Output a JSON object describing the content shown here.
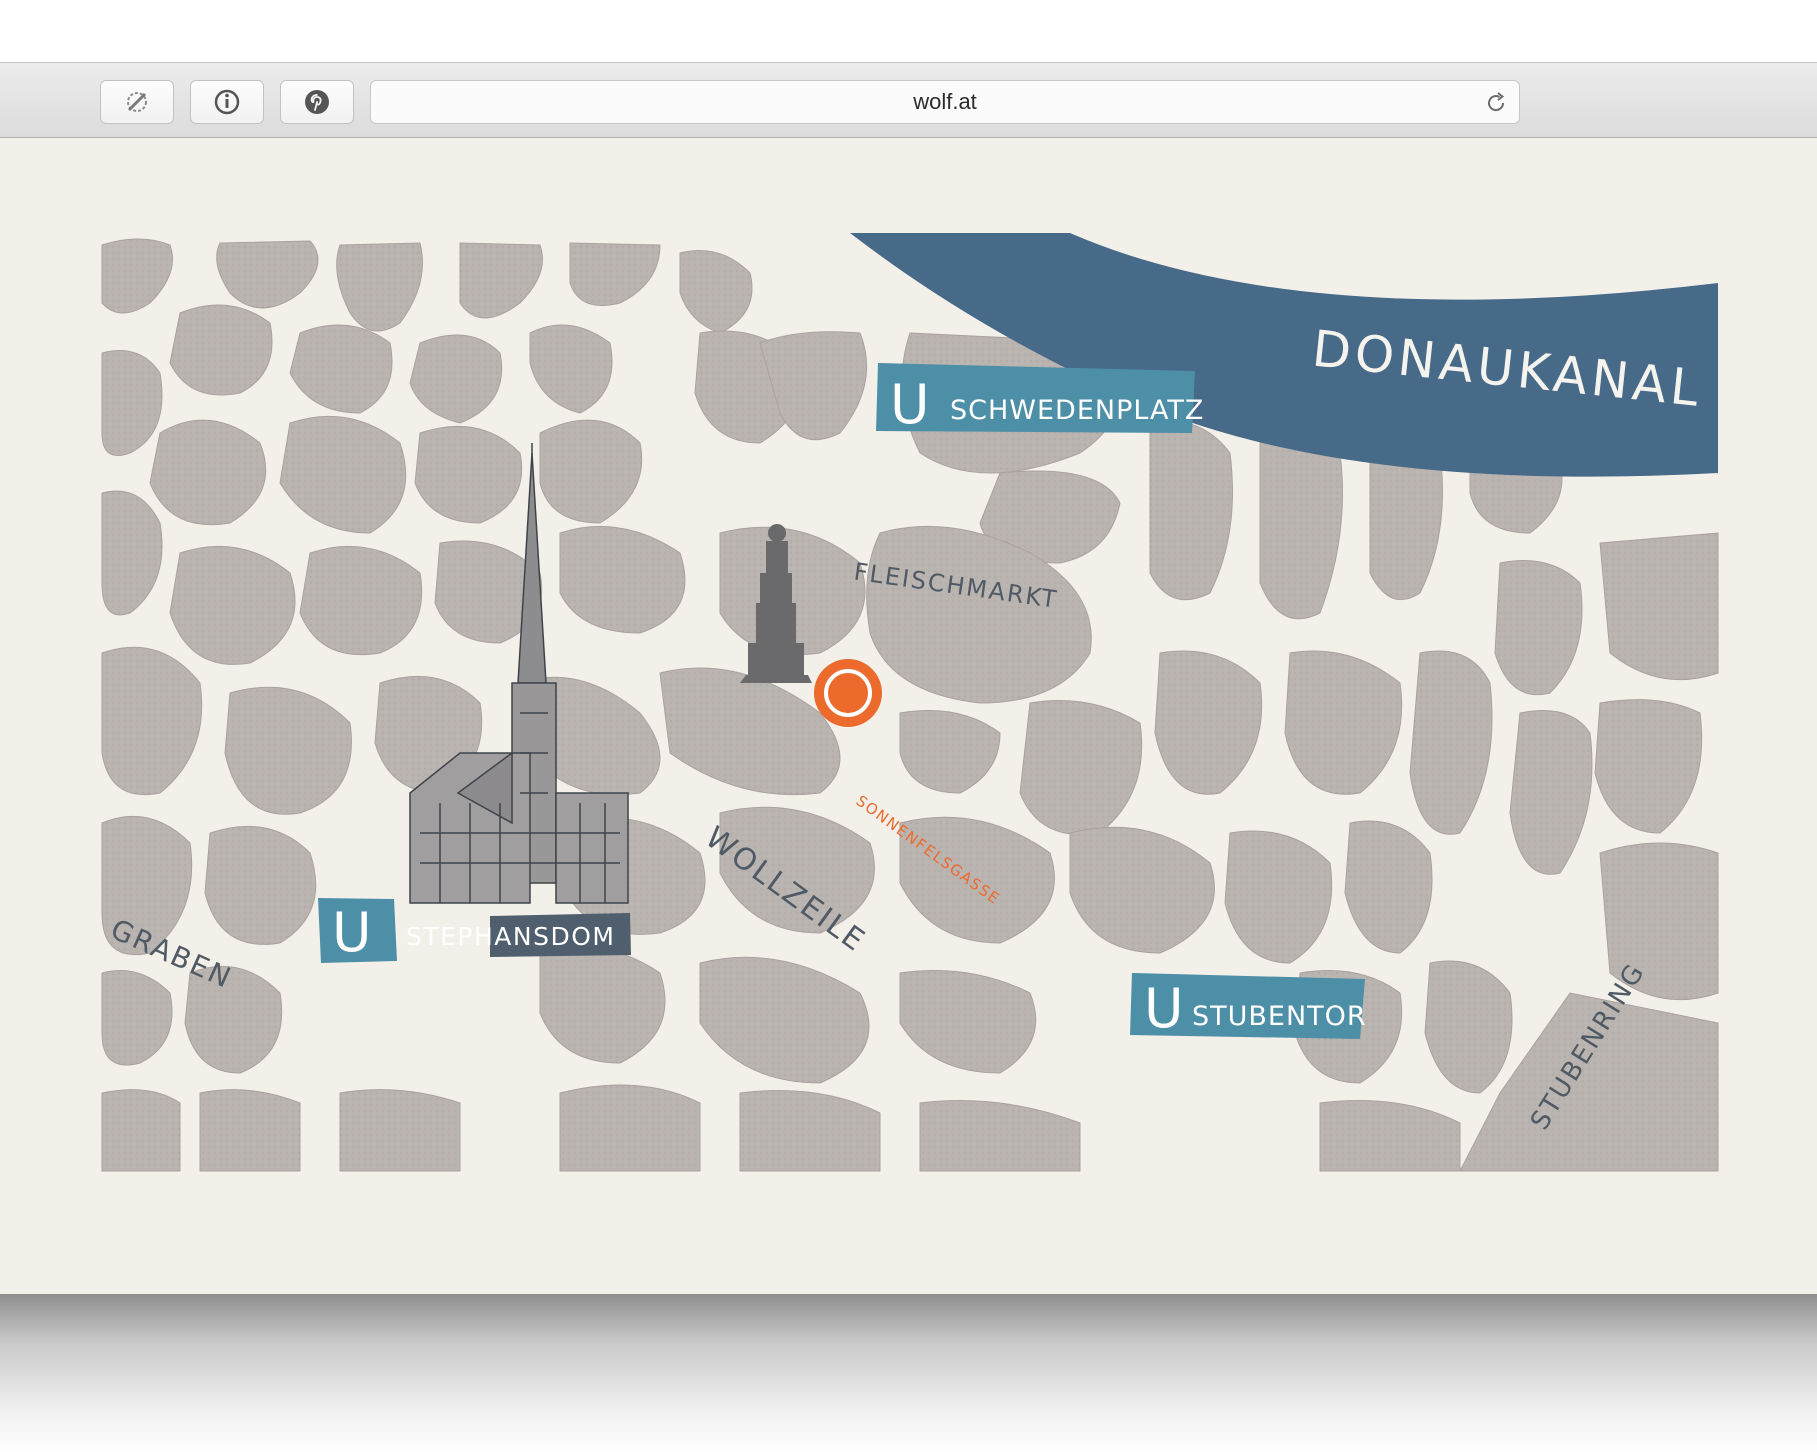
{
  "browser": {
    "url": "wolf.at",
    "buttons": [
      {
        "name": "extension-icon"
      },
      {
        "name": "info-icon"
      },
      {
        "name": "pinterest-icon"
      }
    ],
    "reload_icon": "reload-icon"
  },
  "map": {
    "river_label": "DONAUKANAL",
    "streets": {
      "fleischmarkt": "FLEISCHMARKT",
      "wollzeile": "WOLLZEILE",
      "graben": "GRABEN",
      "stubenring": "STUBENRING",
      "sonnenfelsgasse": "SONNENFELSGASSE"
    },
    "stations": {
      "schwedenplatz": {
        "badge": "U",
        "label": "SCHWEDENPLATZ"
      },
      "stephansdom": {
        "badge": "U",
        "label": "STEPHANSDOM"
      },
      "stubentor": {
        "badge": "U",
        "label": "STUBENTOR"
      }
    },
    "landmarks": [
      "cathedral-illustration",
      "statue-illustration"
    ],
    "location_marker": "location-pin-icon",
    "colors": {
      "background": "#f3f0ea",
      "blocks": "#b9b3b0",
      "river": "#466a88",
      "station_badge": "#4e8fa8",
      "station_label_bg": "#4f5f6d",
      "marker": "#ec6a2c"
    }
  }
}
